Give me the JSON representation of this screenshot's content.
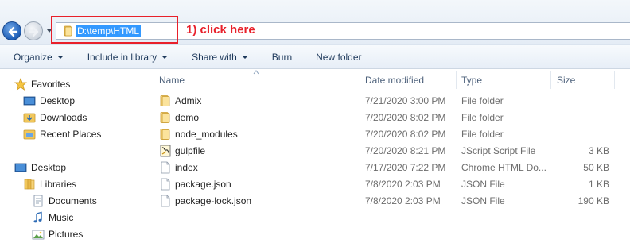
{
  "address": {
    "path": "D:\\temp\\HTML",
    "annotation": "1) click here"
  },
  "toolbar": {
    "organize": "Organize",
    "include_in_library": "Include in library",
    "share_with": "Share with",
    "burn": "Burn",
    "new_folder": "New folder"
  },
  "navpane": {
    "favorites": "Favorites",
    "desktop_fav": "Desktop",
    "downloads": "Downloads",
    "recent_places": "Recent Places",
    "desktop": "Desktop",
    "libraries": "Libraries",
    "documents": "Documents",
    "music": "Music",
    "pictures": "Pictures"
  },
  "columns": {
    "name": "Name",
    "date": "Date modified",
    "type": "Type",
    "size": "Size"
  },
  "files": [
    {
      "name": "Admix",
      "date": "7/21/2020 3:00 PM",
      "type": "File folder",
      "size": "",
      "icon": "folder-icon"
    },
    {
      "name": "demo",
      "date": "7/20/2020 8:02 PM",
      "type": "File folder",
      "size": "",
      "icon": "folder-icon"
    },
    {
      "name": "node_modules",
      "date": "7/20/2020 8:02 PM",
      "type": "File folder",
      "size": "",
      "icon": "folder-icon"
    },
    {
      "name": "gulpfile",
      "date": "7/20/2020 8:21 PM",
      "type": "JScript Script File",
      "size": "3 KB",
      "icon": "script-icon"
    },
    {
      "name": "index",
      "date": "7/17/2020 7:22 PM",
      "type": "Chrome HTML Do...",
      "size": "50 KB",
      "icon": "document-icon"
    },
    {
      "name": "package.json",
      "date": "7/8/2020 2:03 PM",
      "type": "JSON File",
      "size": "1 KB",
      "icon": "document-icon"
    },
    {
      "name": "package-lock.json",
      "date": "7/8/2020 2:03 PM",
      "type": "JSON File",
      "size": "190 KB",
      "icon": "document-icon"
    }
  ],
  "colors": {
    "highlight": "#e8202a",
    "selection": "#3399ff",
    "folder": "#e8b84a"
  }
}
